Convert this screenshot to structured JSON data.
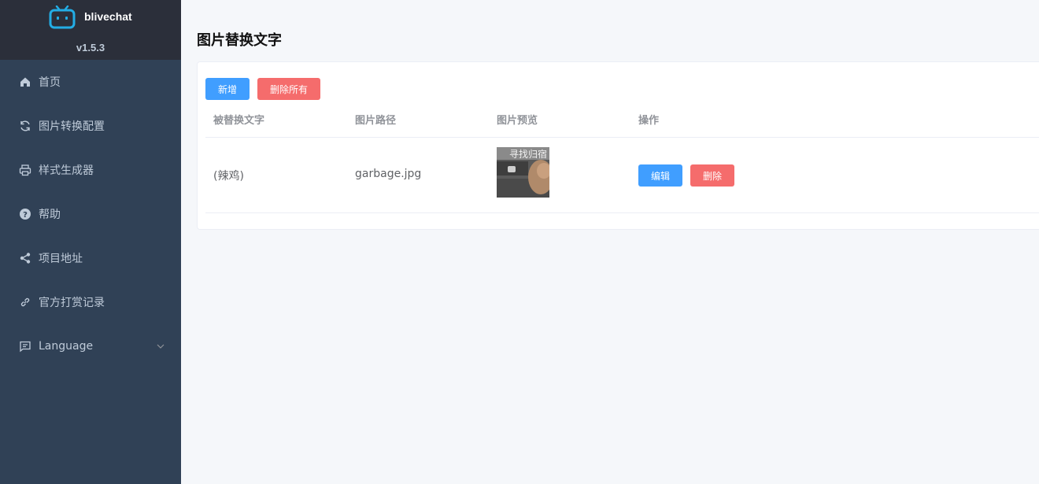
{
  "app": {
    "name": "blivechat",
    "version": "v1.5.3"
  },
  "sidebar": {
    "items": [
      {
        "label": "首页",
        "icon": "home-icon"
      },
      {
        "label": "图片转换配置",
        "icon": "refresh-icon"
      },
      {
        "label": "样式生成器",
        "icon": "printer-icon"
      },
      {
        "label": "帮助",
        "icon": "help-icon"
      },
      {
        "label": "项目地址",
        "icon": "share-icon"
      },
      {
        "label": "官方打赏记录",
        "icon": "link-icon"
      },
      {
        "label": "Language",
        "icon": "message-icon"
      }
    ]
  },
  "main": {
    "title": "图片替换文字",
    "toolbar": {
      "add_label": "新增",
      "delete_all_label": "删除所有"
    },
    "table": {
      "columns": [
        "被替换文字",
        "图片路径",
        "图片预览",
        "操作"
      ],
      "rows": [
        {
          "text": "(辣鸡)",
          "path": "garbage.jpg",
          "preview_caption": "寻找归宿",
          "edit_label": "编辑",
          "delete_label": "删除"
        }
      ]
    }
  },
  "colors": {
    "sidebar_bg": "#304156",
    "brand_bg": "#2b2f3a",
    "primary": "#409eff",
    "danger": "#f56c6c",
    "page_bg": "#f5f7fa"
  }
}
